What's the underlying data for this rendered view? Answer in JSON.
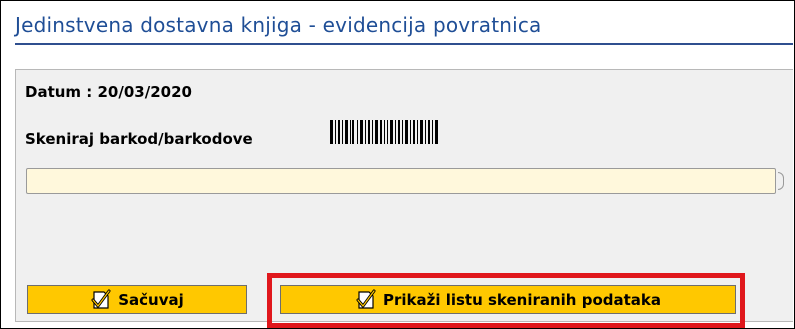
{
  "window": {
    "title": "Jedinstvena dostavna knjiga - evidencija povratnica"
  },
  "form": {
    "date_label": "Datum : 20/03/2020",
    "scan_label": "Skeniraj barkod/barkodove",
    "barcode_icon": "barcode-icon",
    "scan_input": {
      "value": "",
      "placeholder": ""
    }
  },
  "buttons": {
    "save_label": "Sačuvaj",
    "show_list_label": "Prikaži listu skeniranih podataka",
    "icon": "checkmark-document-icon"
  },
  "colors": {
    "title": "#1f4e96",
    "button_bg": "#ffc800",
    "input_bg": "#fff8dc",
    "highlight": "#e0171c"
  }
}
